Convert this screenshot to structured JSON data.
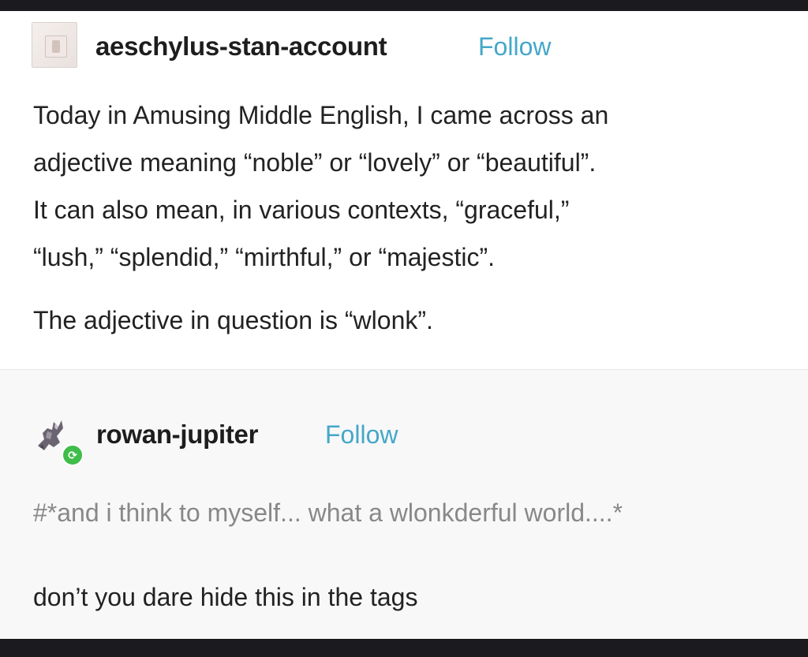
{
  "post": {
    "author": "aeschylus-stan-account",
    "follow_label": "Follow",
    "lines": [
      "Today in Amusing Middle English, I came across an",
      "adjective meaning “noble” or “lovely” or “beautiful”.",
      "It can also mean, in various contexts, “graceful,”",
      "“lush,” “splendid,” “mirthful,” or “majestic”."
    ],
    "line_last": "The adjective in question is “wlonk”."
  },
  "reblog": {
    "author": "rowan-jupiter",
    "follow_label": "Follow",
    "tag": "#*and i think to myself... what a wlonkderful world....*",
    "comment": "don’t you dare hide this in the tags"
  },
  "icons": {
    "avatar1": "aeschylus-avatar-icon",
    "avatar2": "rowan-avatar-icon",
    "reblog_badge": "reblog-icon"
  },
  "colors": {
    "follow": "#45a7c9",
    "text": "#222222",
    "tag": "#888888",
    "reblog_badge": "#3fbd4a"
  }
}
